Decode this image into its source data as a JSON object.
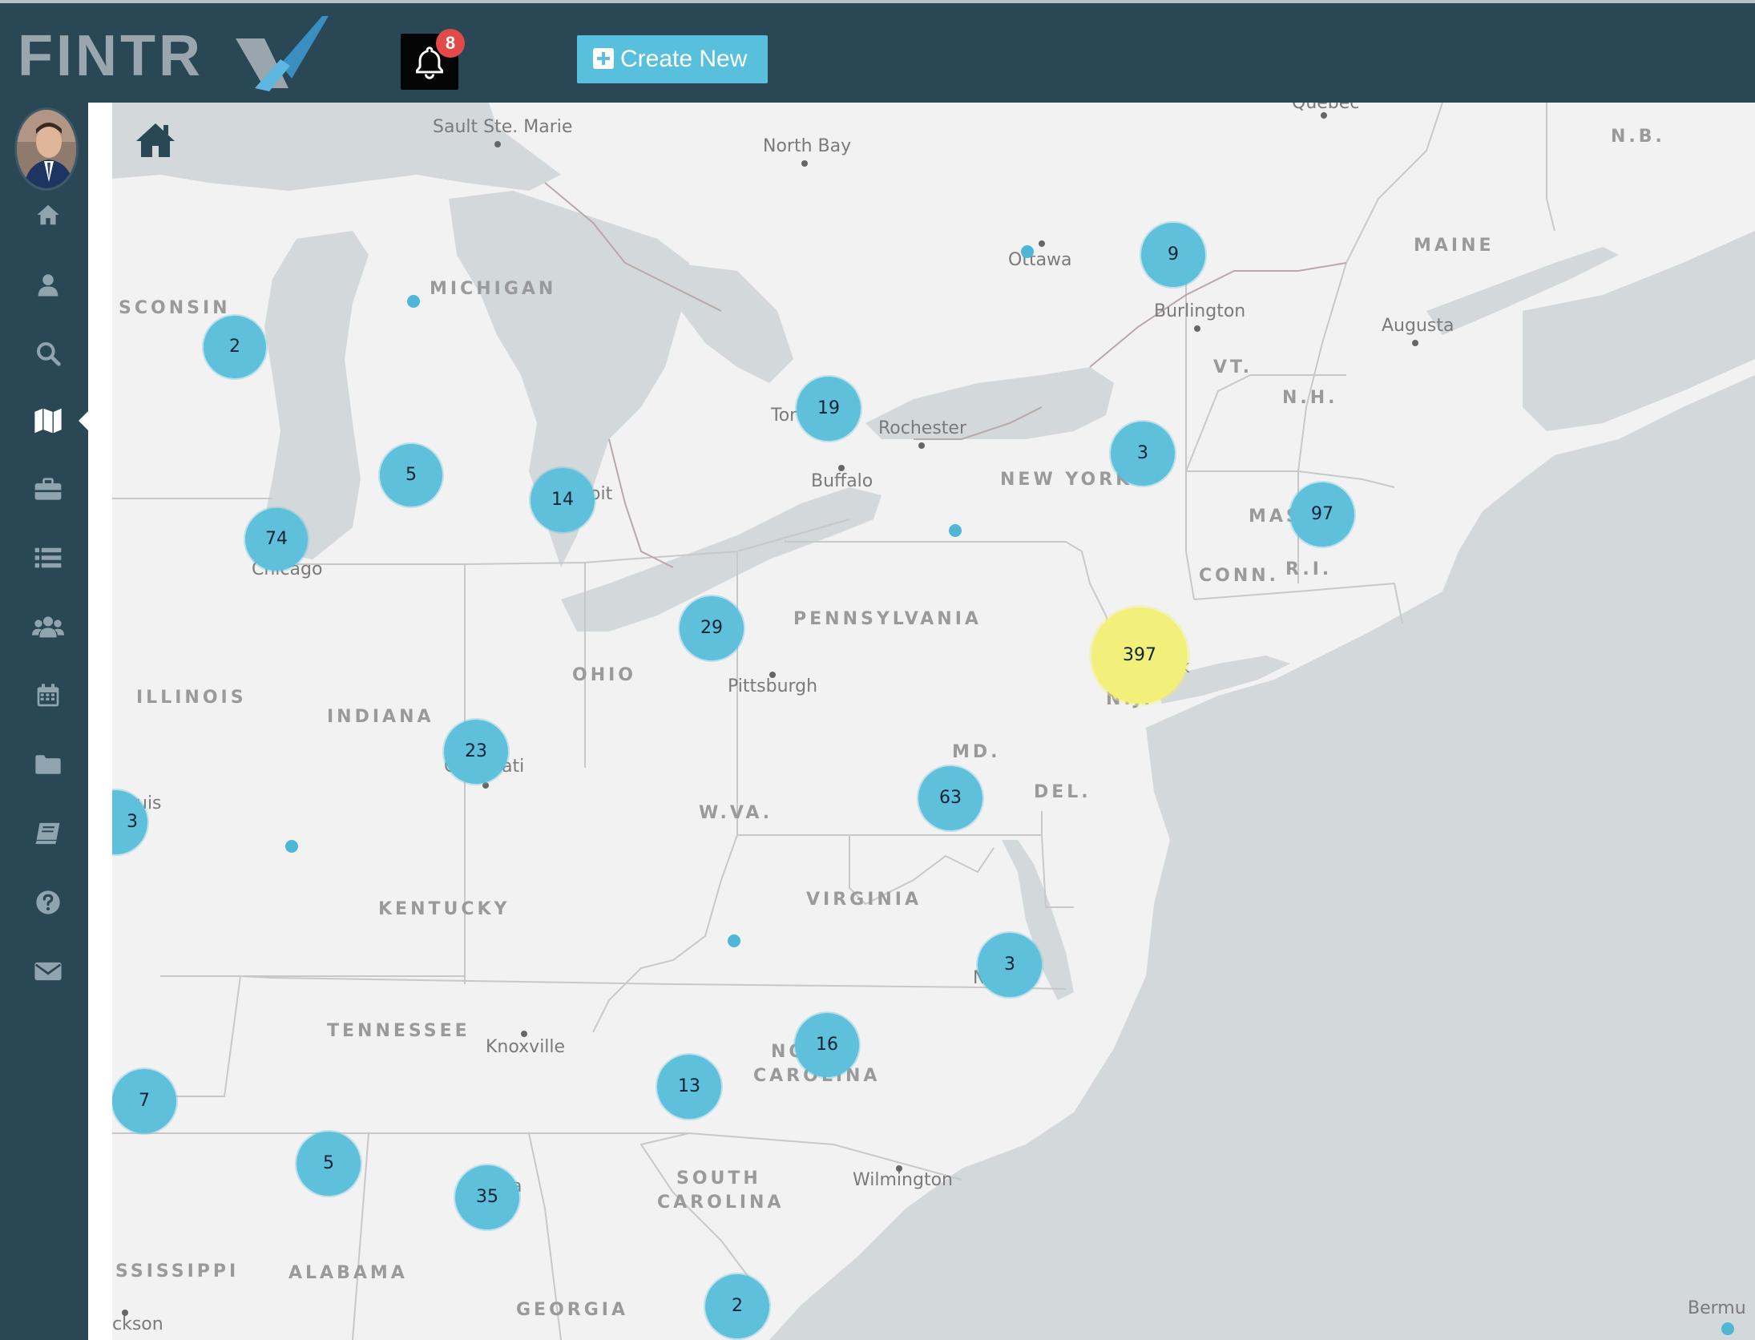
{
  "header": {
    "logo_text": "FINTR",
    "logo_x": "X",
    "notifications_count": "8",
    "create_new_label": "Create New"
  },
  "colors": {
    "topbar": "#294755",
    "accent": "#58c0dc",
    "cluster": "#5ec0db",
    "cluster_large": "#f2f07a",
    "badge": "#e24a4a",
    "water": "#d3d8da",
    "land": "#f2f2f2"
  },
  "sidebar": {
    "items": [
      {
        "icon": "home-icon"
      },
      {
        "icon": "user-icon"
      },
      {
        "icon": "search-icon"
      },
      {
        "icon": "map-icon",
        "active": true
      },
      {
        "icon": "briefcase-icon"
      },
      {
        "icon": "list-icon"
      },
      {
        "icon": "users-icon"
      },
      {
        "icon": "calendar-icon"
      },
      {
        "icon": "folder-icon"
      },
      {
        "icon": "book-icon"
      },
      {
        "icon": "help-icon"
      },
      {
        "icon": "envelope-icon"
      }
    ]
  },
  "map": {
    "state_labels": [
      "SCONSIN",
      "MICHIGAN",
      "ILLINOIS",
      "INDIANA",
      "OHIO",
      "PENNSYLVANIA",
      "NEW YORK",
      "KENTUCKY",
      "W.VA.",
      "VIRGINIA",
      "TENNESSEE",
      "NO",
      "CAROLINA",
      "SOUTH",
      "CAROLINA",
      "SSISSIPPI",
      "ALABAMA",
      "GEORGIA",
      "MAINE",
      "VT.",
      "N.H.",
      "MASS",
      "CONN.",
      "R.I.",
      "MD.",
      "DEL.",
      "N.B.",
      "N.J."
    ],
    "city_labels": [
      "Sault Ste. Marie",
      "North Bay",
      "Ottawa",
      "Burlington",
      "Augusta",
      "Tor",
      "Rochester",
      "Buffalo",
      "oit",
      "Chicago",
      "Pittsburgh",
      "ati",
      "C",
      "uis",
      "Knoxville",
      "Wilmington",
      "a",
      "ckson",
      "Bermu",
      "Quebec",
      "k",
      "N"
    ],
    "clusters": [
      "2",
      "5",
      "74",
      "14",
      "19",
      "9",
      "3",
      "97",
      "397",
      "29",
      "23",
      "3",
      "63",
      "3",
      "16",
      "13",
      "7",
      "5",
      "35",
      "2"
    ]
  }
}
